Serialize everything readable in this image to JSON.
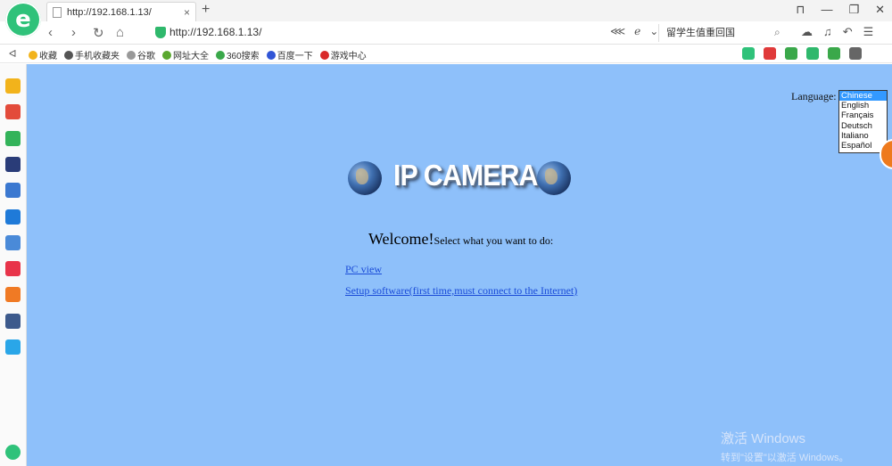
{
  "browser": {
    "logo_glyph": "e",
    "tab": {
      "title": "http://192.168.1.13/",
      "close_glyph": "×"
    },
    "new_tab_glyph": "+",
    "window_controls": [
      "⊓",
      "—",
      "❐",
      "✕"
    ],
    "nav": {
      "back": "‹",
      "forward": "›",
      "reload": "↻",
      "home": "⌂"
    },
    "address": "http://192.168.1.13/",
    "address_right_icons": [
      "⋘",
      "ℯ",
      "⌄"
    ],
    "search_text": "留学生值重回国",
    "search_glyph": "⌕",
    "tools": [
      "☁",
      "♫",
      "↶",
      "☰"
    ]
  },
  "bookmarks": {
    "collapse_glyph": "ᐊ",
    "items": [
      {
        "label": "收藏",
        "color": "#f2b31b"
      },
      {
        "label": "手机收藏夹",
        "color": "#555555"
      },
      {
        "label": "谷歌",
        "color": "#999999"
      },
      {
        "label": "网址大全",
        "color": "#5aa82f"
      },
      {
        "label": "360搜索",
        "color": "#3aa84a"
      },
      {
        "label": "百度一下",
        "color": "#3155d6"
      },
      {
        "label": "游戏中心",
        "color": "#d92a2a"
      }
    ],
    "tool_colors": [
      "#2fc27a",
      "#e03a3a",
      "#3aa84a",
      "#2fb86c",
      "#3aa84a",
      "#666666"
    ]
  },
  "sidebar": {
    "icon_colors": [
      "#f2b31b",
      "#e34b3b",
      "#33b35a",
      "#2a3c78",
      "#3b78d0",
      "#1f7ad8",
      "#4a8ad8",
      "#e8344a",
      "#f07a24",
      "#3d5a8c",
      "#2aa6e8"
    ]
  },
  "page": {
    "background": "#8ec0fa",
    "language_label": "Language:",
    "languages": [
      "Chinese",
      "English",
      "Français",
      "Deutsch",
      "Italiano",
      "Español"
    ],
    "selected_language": "Chinese",
    "title": "IP CAMERA",
    "welcome_big": "Welcome!",
    "welcome_small": "Select what you want to do:",
    "link_pc_view": "PC view",
    "link_setup": "Setup software(first time,must connect to the Internet)"
  },
  "watermark": {
    "line1": "激活 Windows",
    "line2": "转到\"设置\"以激活 Windows。"
  }
}
